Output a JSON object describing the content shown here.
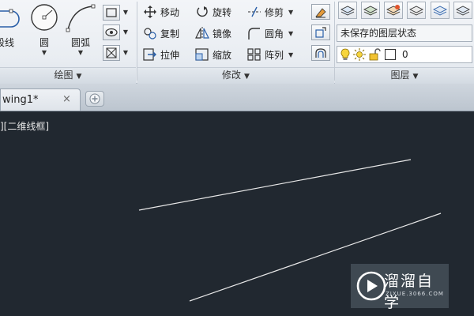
{
  "ribbon": {
    "draw_panel": {
      "title": "绘图",
      "tools": [
        {
          "label": "多段线"
        },
        {
          "label": "圆"
        },
        {
          "label": "圆弧"
        }
      ]
    },
    "modify_panel": {
      "title": "修改",
      "tools": [
        {
          "label": "移动"
        },
        {
          "label": "旋转"
        },
        {
          "label": "修剪"
        },
        {
          "label": "复制"
        },
        {
          "label": "镜像"
        },
        {
          "label": "圆角"
        },
        {
          "label": "拉伸"
        },
        {
          "label": "缩放"
        },
        {
          "label": "阵列"
        }
      ]
    },
    "layer_panel": {
      "title": "图层",
      "state_value": "未保存的图层状态",
      "current_layer": "0"
    },
    "panel_dropdown_glyph": "▼"
  },
  "tabs": {
    "document_tab": "wing1*",
    "close_glyph": "×"
  },
  "canvas": {
    "viewport_label": "][二维线框]"
  },
  "watermark": {
    "text": "溜溜自学",
    "sub": "ZIXUE.3066.COM"
  }
}
